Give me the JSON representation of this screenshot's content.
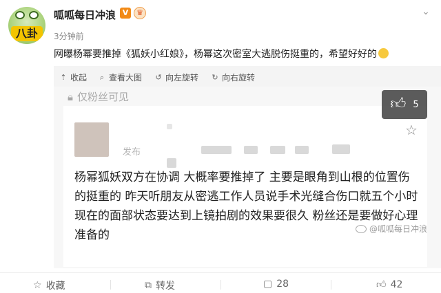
{
  "header": {
    "username": "呱呱每日冲浪",
    "vip_badge": "V",
    "time": "3分钟前",
    "avatar_text": "八卦"
  },
  "post": {
    "text": "网曝杨幂要推掉《狐妖小红娘》，杨幂这次密室大逃脱伤挺重的，希望好好的"
  },
  "image_toolbar": {
    "collapse": "收起",
    "view_large": "查看大图",
    "rotate_left": "向左旋转",
    "rotate_right": "向右旋转"
  },
  "image": {
    "fans_only": "仅粉丝可见",
    "publish_label": "发布",
    "quote": "杨幂狐妖双方在协调 大概率要推掉了 主要是眼角到山根的位置伤的挺重的 昨天听朋友从密逃工作人员说手术光缝合伤口就五个小时 现在的面部状态要达到上镜拍剧的效果要很久 粉丝还是要做好心理准备的",
    "watermark": "@呱呱每日冲浪",
    "likes_overlay": "5"
  },
  "actions": {
    "favorite": "收藏",
    "repost": "转发",
    "comments": "28",
    "likes": "42"
  },
  "colors": {
    "vip": "#f28a16",
    "overlay": "#464646"
  }
}
